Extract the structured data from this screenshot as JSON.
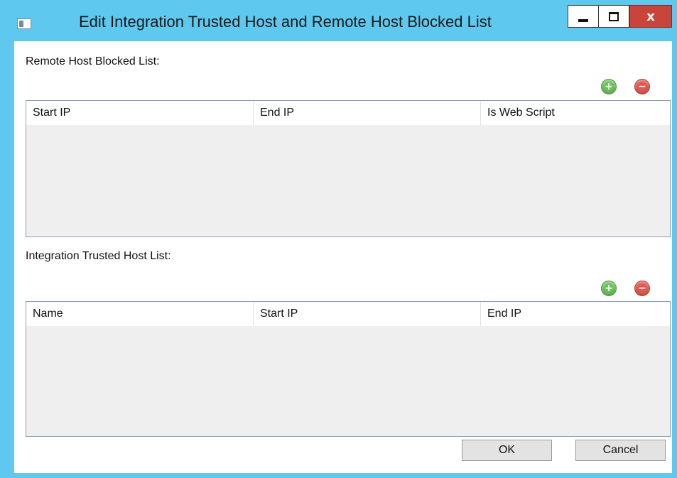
{
  "window": {
    "title": "Edit Integration Trusted Host and Remote Host Blocked List",
    "controls": {
      "close_label": "x"
    }
  },
  "remote_blocked": {
    "label": "Remote Host Blocked List:",
    "add_icon": "plus-circle-icon",
    "remove_icon": "minus-circle-icon",
    "columns": [
      "Start IP",
      "End IP",
      "Is Web Script"
    ],
    "rows": []
  },
  "trusted_hosts": {
    "label": "Integration Trusted Host List:",
    "add_icon": "plus-circle-icon",
    "remove_icon": "minus-circle-icon",
    "columns": [
      "Name",
      "Start IP",
      "End IP"
    ],
    "rows": []
  },
  "buttons": {
    "ok": "OK",
    "cancel": "Cancel"
  },
  "colors": {
    "titlebar": "#5ec8ee",
    "close_button": "#c9443b",
    "add_button": "#6fc05d",
    "remove_button": "#e0584f"
  }
}
